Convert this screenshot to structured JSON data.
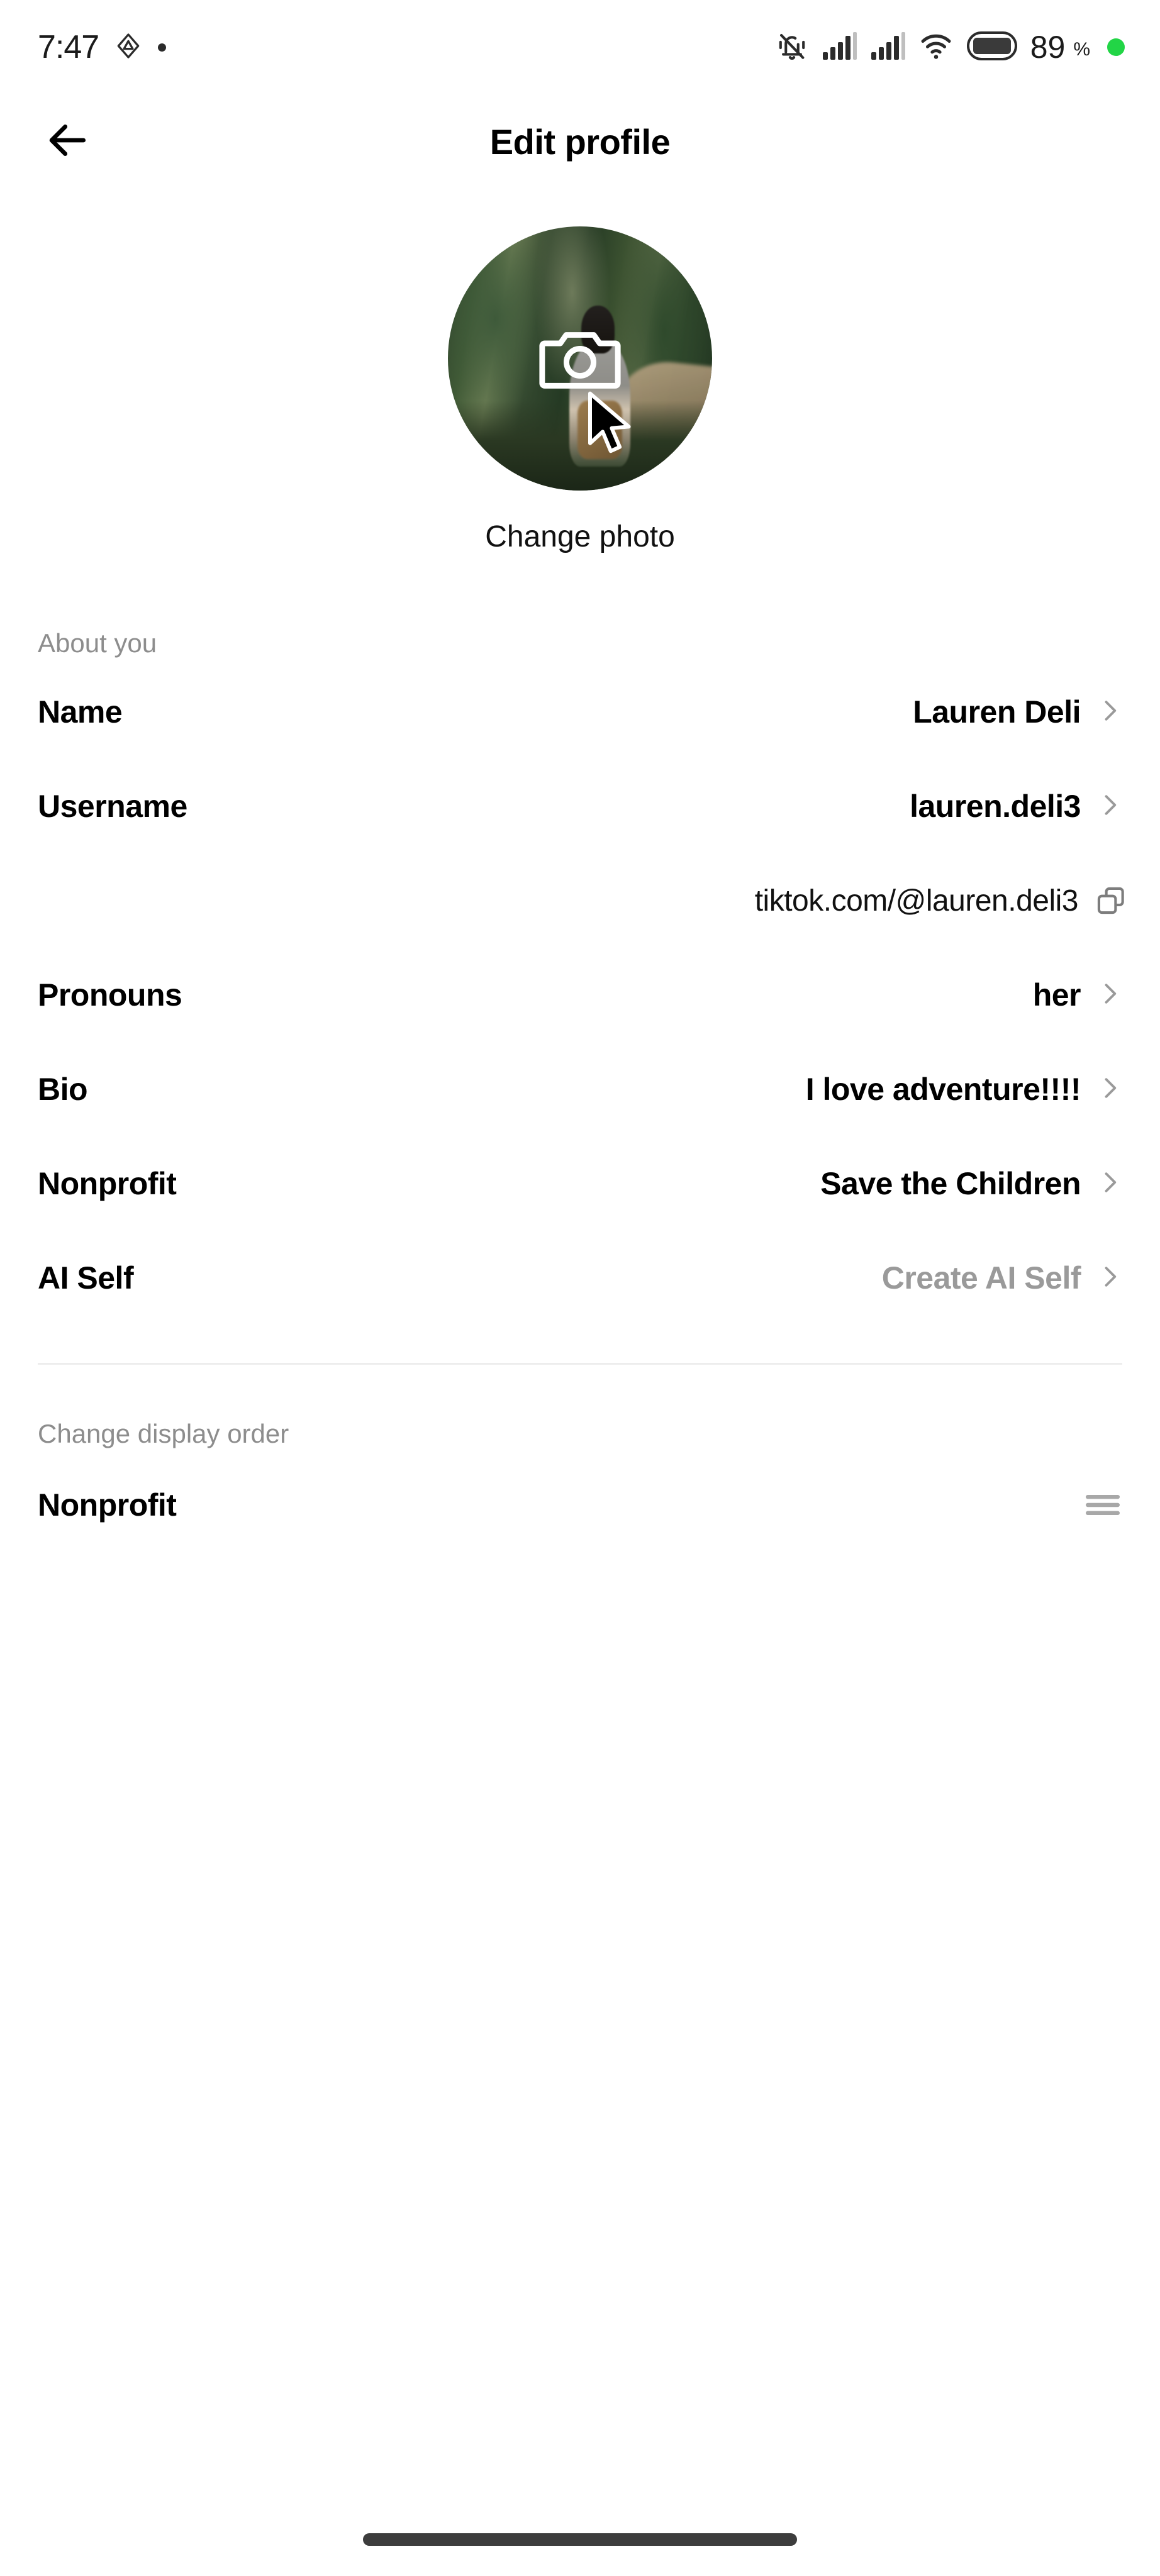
{
  "status_bar": {
    "time": "7:47",
    "left_icons": [
      "triangle-badge-icon",
      "small-dot-icon"
    ],
    "right_icons": [
      "vibrate-off-icon",
      "signal-bars-icon",
      "signal-bars-2-icon",
      "wifi-icon",
      "battery-icon",
      "green-status-dot"
    ],
    "battery_level": "89",
    "battery_unit": "%",
    "accent_green": "#22d546"
  },
  "header": {
    "back_icon": "arrow-left-icon",
    "title": "Edit profile"
  },
  "avatar": {
    "camera_icon": "camera-icon",
    "cursor_icon": "mouse-cursor-icon",
    "change_photo_label": "Change photo"
  },
  "about_section": {
    "label": "About you",
    "rows": [
      {
        "label": "Name",
        "value": "Lauren Deli",
        "chevron": "chevron-right-icon",
        "muted": false
      },
      {
        "label": "Username",
        "value": "lauren.deli3",
        "chevron": "chevron-right-icon",
        "muted": false
      },
      {
        "label": "Pronouns",
        "value": "her",
        "chevron": "chevron-right-icon",
        "muted": false
      },
      {
        "label": "Bio",
        "value": "I love adventure!!!!",
        "chevron": "chevron-right-icon",
        "muted": false
      },
      {
        "label": "Nonprofit",
        "value": "Save the Children",
        "chevron": "chevron-right-icon",
        "muted": false
      },
      {
        "label": "AI Self",
        "value": "Create AI Self",
        "chevron": "chevron-right-icon",
        "muted": true
      }
    ],
    "profile_url": "tiktok.com/@lauren.deli3",
    "copy_icon": "copy-icon"
  },
  "display_order_section": {
    "label": "Change display order",
    "items": [
      {
        "label": "Nonprofit",
        "handle_icon": "drag-handle-icon"
      }
    ]
  },
  "system_nav": {
    "home_indicator": "home-indicator"
  }
}
